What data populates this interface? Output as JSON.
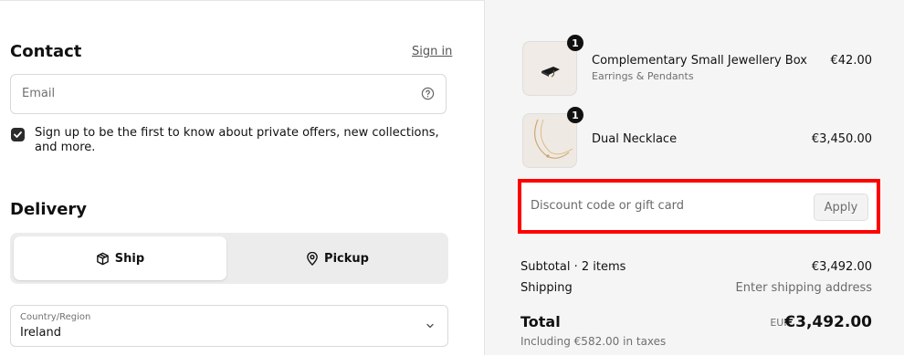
{
  "contact": {
    "heading": "Contact",
    "sign_in": "Sign in",
    "email_placeholder": "Email",
    "newsletter_label": "Sign up to be the first to know about private offers, new collections, and more.",
    "newsletter_checked": true
  },
  "delivery": {
    "heading": "Delivery",
    "options": [
      "Ship",
      "Pickup"
    ],
    "selected": "Ship",
    "country_label": "Country/Region",
    "country_value": "Ireland"
  },
  "cart": {
    "items": [
      {
        "name": "Complementary Small Jewellery Box",
        "variant": "Earrings & Pendants",
        "price": "€42.00",
        "quantity": "1",
        "image_icon": "jewellery-box-icon"
      },
      {
        "name": "Dual Necklace",
        "variant": "",
        "price": "€3,450.00",
        "quantity": "1",
        "image_icon": "necklace-icon"
      }
    ],
    "discount_placeholder": "Discount code or gift card",
    "apply_label": "Apply",
    "subtotal_label": "Subtotal · 2 items",
    "subtotal_value": "€3,492.00",
    "shipping_label": "Shipping",
    "shipping_value": "Enter shipping address",
    "total_label": "Total",
    "currency": "EUR",
    "total_value": "€3,492.00",
    "taxes_note": "Including €582.00 in taxes"
  },
  "colors": {
    "highlight": "#ff0000",
    "summary_bg": "#f5f5f5"
  }
}
